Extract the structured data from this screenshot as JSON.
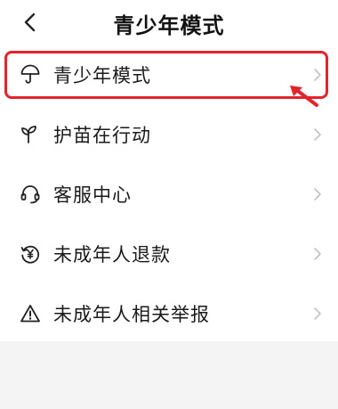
{
  "header": {
    "title": "青少年模式",
    "back_icon": "chevron-left-icon"
  },
  "menu": {
    "items": [
      {
        "label": "青少年模式",
        "icon": "umbrella-icon",
        "highlighted": true
      },
      {
        "label": "护苗在行动",
        "icon": "sprout-icon"
      },
      {
        "label": "客服中心",
        "icon": "headset-icon"
      },
      {
        "label": "未成年人退款",
        "icon": "refund-yen-icon"
      },
      {
        "label": "未成年人相关举报",
        "icon": "warning-triangle-icon"
      }
    ],
    "chevron_icon": "chevron-right-icon"
  },
  "colors": {
    "highlight": "#e3242b",
    "chevron": "#c2c2c2",
    "background_gap": "#f4f4f5"
  }
}
